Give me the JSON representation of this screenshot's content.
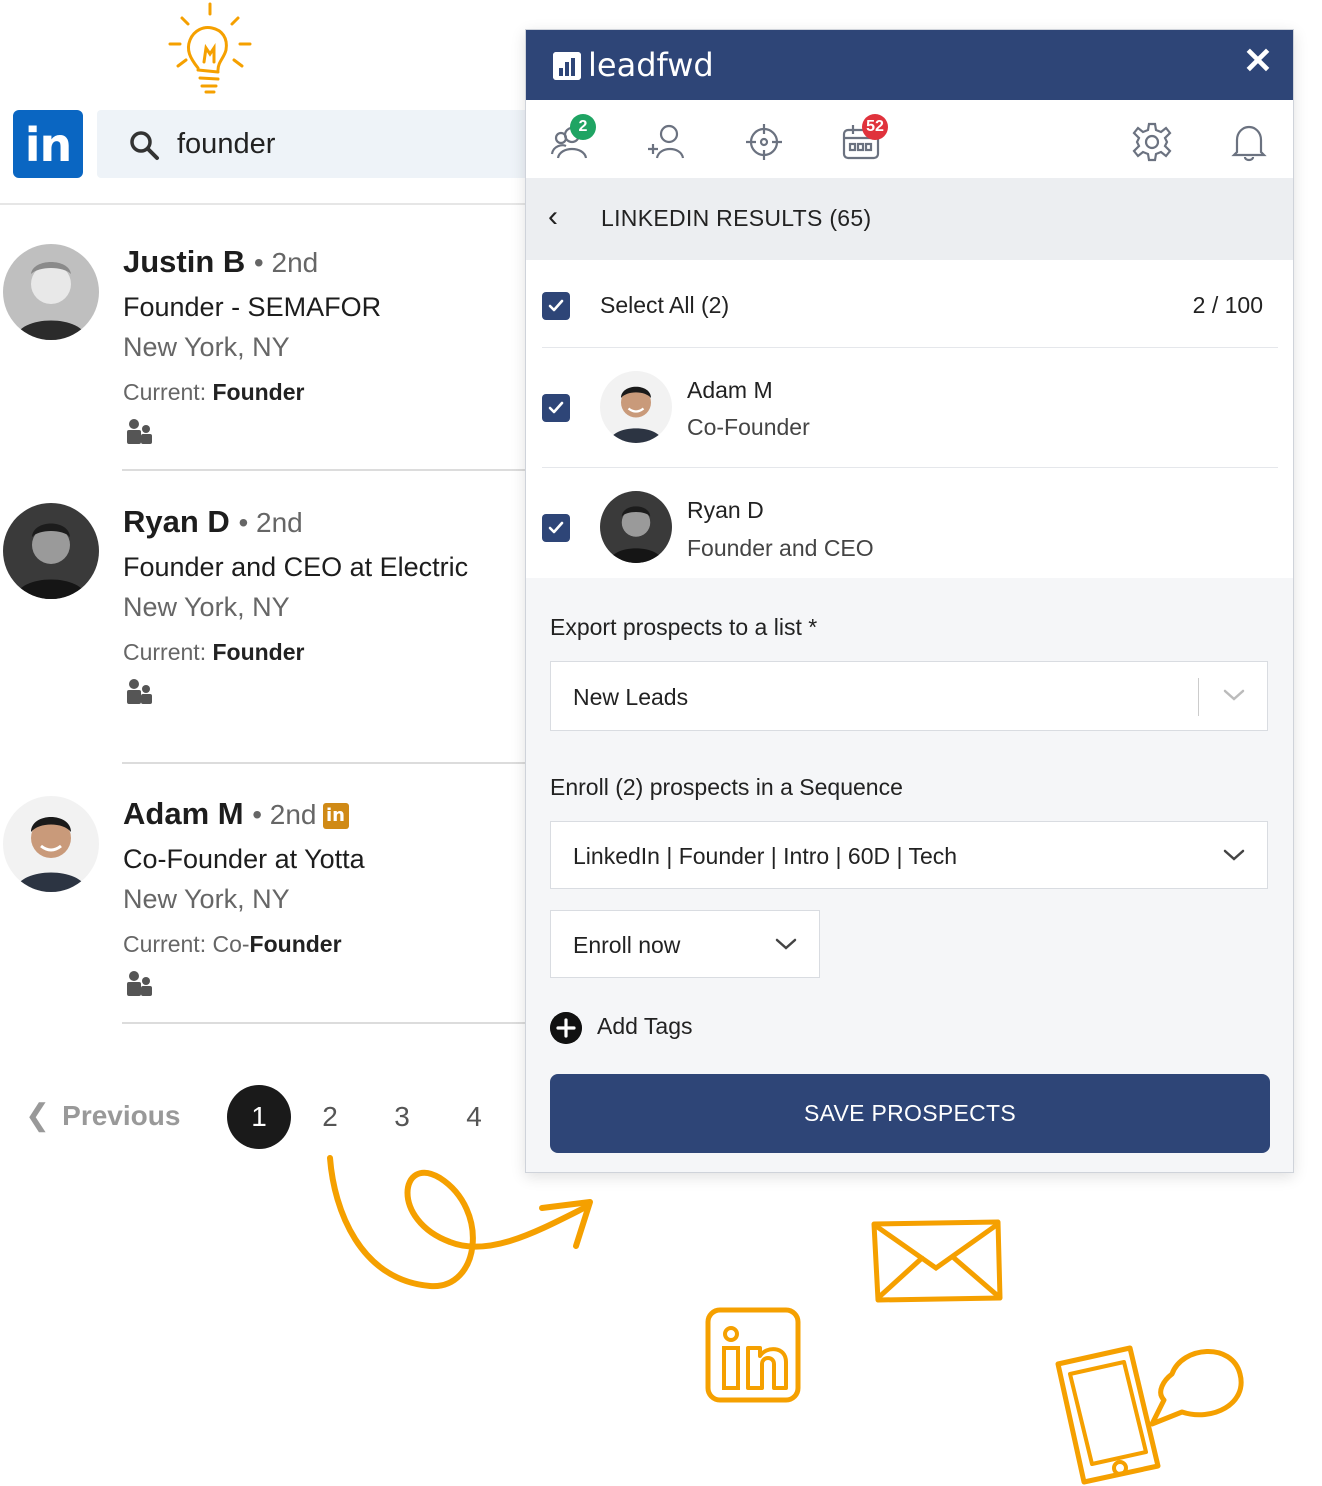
{
  "linkedin": {
    "logo_text": "in",
    "search_value": "founder",
    "people": [
      {
        "name": "Justin B",
        "degree": "• 2nd",
        "title": "Founder - SEMAFOR",
        "location": "New York, NY",
        "current_label": "Current:",
        "current_prefix": "",
        "current_bold": "Founder"
      },
      {
        "name": "Ryan D",
        "degree": "• 2nd",
        "title": "Founder and CEO at Electric",
        "location": "New York, NY",
        "current_label": "Current:",
        "current_prefix": "",
        "current_bold": "Founder"
      },
      {
        "name": "Adam M",
        "degree": "• 2nd",
        "badge": "in",
        "title": "Co-Founder at Yotta",
        "location": "New York, NY",
        "current_label": "Current:",
        "current_prefix": " Co-",
        "current_bold": "Founder"
      }
    ],
    "pagination": {
      "previous": "Previous",
      "pages": [
        "1",
        "2",
        "3",
        "4"
      ],
      "active": "1"
    }
  },
  "panel": {
    "brand": "leadfwd",
    "close": "✕",
    "tabs": [
      {
        "icon": "people-group-icon",
        "badge": "2",
        "badge_color": "#1fa463"
      },
      {
        "icon": "add-person-icon"
      },
      {
        "icon": "crosshair-icon"
      },
      {
        "icon": "calendar-icon",
        "badge": "52",
        "badge_color": "#e0323c"
      },
      {
        "icon": "gear-icon"
      },
      {
        "icon": "bell-icon"
      }
    ],
    "nav": {
      "back": "‹",
      "title": "LINKEDIN RESULTS (65)"
    },
    "select_all": {
      "label": "Select All (2)",
      "count": "2 / 100"
    },
    "results": [
      {
        "name": "Adam M",
        "role": "Co-Founder"
      },
      {
        "name": "Ryan D",
        "role": "Founder and CEO"
      }
    ],
    "export": {
      "label": "Export prospects to a list *",
      "value": "New Leads"
    },
    "sequence": {
      "label": "Enroll (2) prospects in a Sequence",
      "value": "LinkedIn | Founder | Intro | 60D | Tech"
    },
    "enroll": {
      "value": "Enroll now"
    },
    "add_tags": "Add Tags",
    "save_button": "SAVE PROSPECTS"
  },
  "colors": {
    "panel_header": "#2e4577",
    "linkedin_blue": "#0a66c2",
    "accent_orange": "#f5a000",
    "background": "#ffffff"
  }
}
